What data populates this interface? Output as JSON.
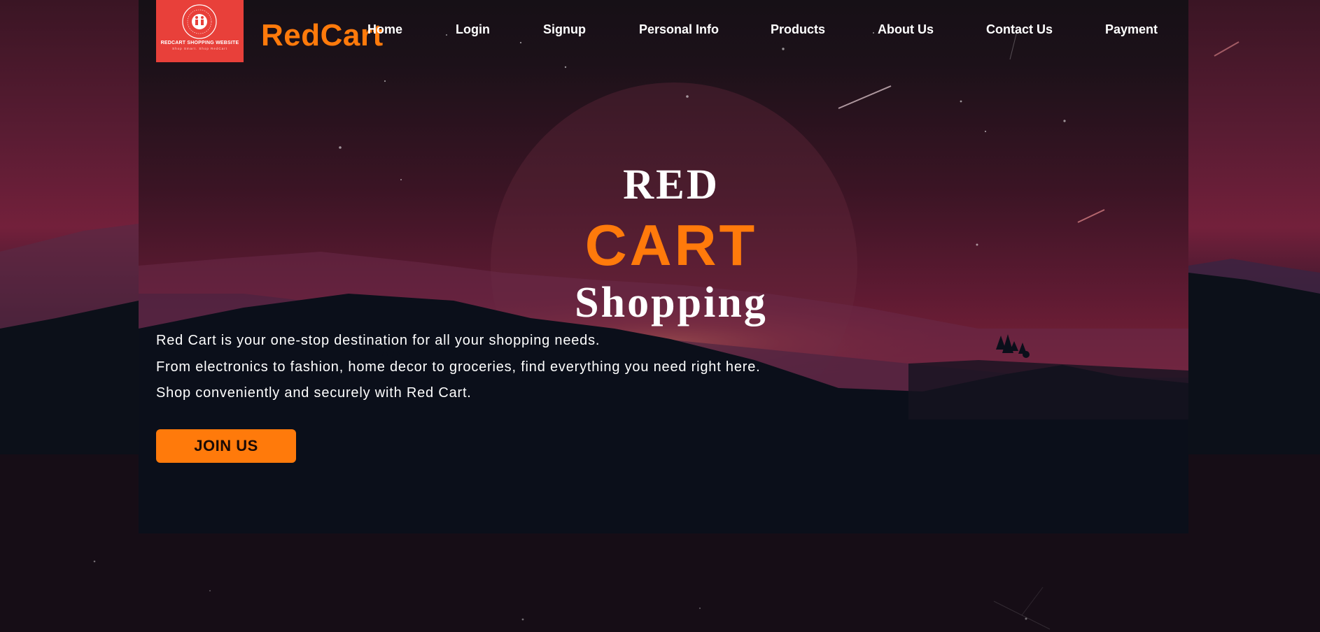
{
  "brand": {
    "name": "RedCart"
  },
  "logo": {
    "caption": "REDCART SHOPPING WEBSITE",
    "tagline": "Shop Smart. Shop RedCart",
    "ring_text": "REDCART SHOPPING WEBSITE"
  },
  "nav": {
    "items": [
      {
        "label": "Home"
      },
      {
        "label": "Login"
      },
      {
        "label": "Signup"
      },
      {
        "label": "Personal Info"
      },
      {
        "label": "Products"
      },
      {
        "label": "About Us"
      },
      {
        "label": "Contact Us"
      },
      {
        "label": "Payment"
      }
    ]
  },
  "hero": {
    "line1": "RED",
    "line2": "CART",
    "line3": "Shopping",
    "description": [
      "Red Cart is your one-stop destination for all your shopping needs.",
      "From electronics to fashion, home decor to groceries, find everything you need right here.",
      "Shop conveniently and securely with Red Cart."
    ],
    "cta_label": "JOIN US"
  },
  "colors": {
    "accent": "#ff7a0b",
    "logo_bg": "#e8403a",
    "text": "#ffffff"
  }
}
